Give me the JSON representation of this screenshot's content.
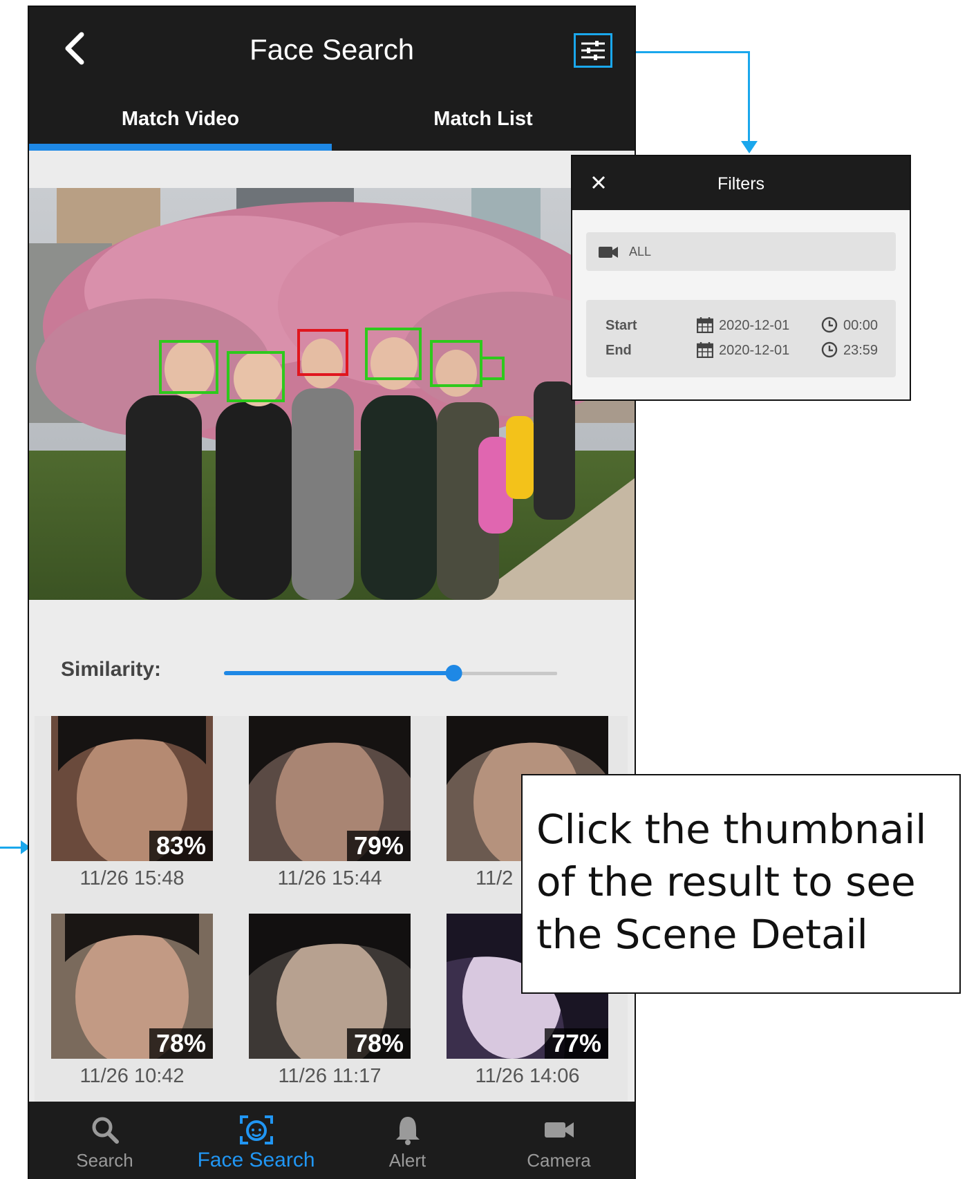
{
  "header": {
    "title": "Face Search"
  },
  "tabs": [
    {
      "label": "Match Video"
    },
    {
      "label": "Match List"
    }
  ],
  "similarity": {
    "label": "Similarity:",
    "value_fraction": 0.7
  },
  "results": [
    {
      "percent": "83%",
      "time": "11/26 15:48"
    },
    {
      "percent": "79%",
      "time": "11/26 15:44"
    },
    {
      "percent": "",
      "time": "11/2"
    },
    {
      "percent": "78%",
      "time": "11/26 10:42"
    },
    {
      "percent": "78%",
      "time": "11/26 11:17"
    },
    {
      "percent": "77%",
      "time": "11/26 14:06"
    }
  ],
  "bottom_nav": [
    {
      "label": "Search",
      "icon": "search-icon"
    },
    {
      "label": "Face Search",
      "icon": "face-search-icon"
    },
    {
      "label": "Alert",
      "icon": "bell-icon"
    },
    {
      "label": "Camera",
      "icon": "camera-icon"
    }
  ],
  "filters": {
    "title": "Filters",
    "camera": "ALL",
    "start_label": "Start",
    "end_label": "End",
    "start_date": "2020-12-01",
    "start_time": "00:00",
    "end_date": "2020-12-01",
    "end_time": "23:59"
  },
  "callout": {
    "text": "Click the thumbnail of the result to see the Scene Detail"
  },
  "colors": {
    "accent": "#1e88e5",
    "highlight": "#1aa7ec",
    "match_box": "#e0161e",
    "face_box": "#2ec91c"
  }
}
